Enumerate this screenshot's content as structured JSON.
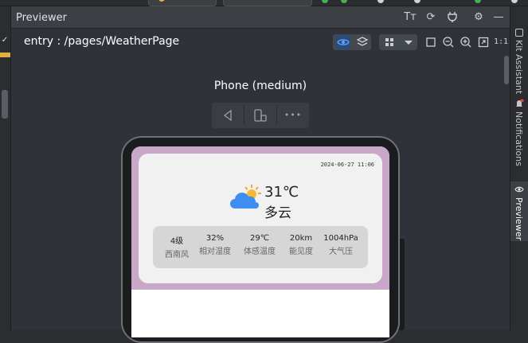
{
  "panel": {
    "title": "Previewer"
  },
  "pathbar": {
    "path": "entry : /pages/WeatherPage"
  },
  "device": {
    "name": "Phone (medium)"
  },
  "weather": {
    "time": "2024-06-27 11:06",
    "temperature": "31℃",
    "condition": "多云",
    "stats": [
      {
        "value": "4级",
        "label": "西南风"
      },
      {
        "value": "32%",
        "label": "相对湿度"
      },
      {
        "value": "29℃",
        "label": "体感温度"
      },
      {
        "value": "20km",
        "label": "能见度"
      },
      {
        "value": "1004hPa",
        "label": "大气压"
      }
    ]
  },
  "right_tabs": {
    "kit_assistant": "Kit Assistant",
    "notifications": "Notifications",
    "previewer": "Previewer"
  },
  "icons": {
    "font": "Tт",
    "refresh": "⟳",
    "settings": "⚙",
    "minimize": "—",
    "back": "◁",
    "more": "•••"
  },
  "colors": {
    "accent": "#3574f0",
    "screen_bg": "#c8a7c8",
    "card_bg": "#f1f1f1"
  }
}
